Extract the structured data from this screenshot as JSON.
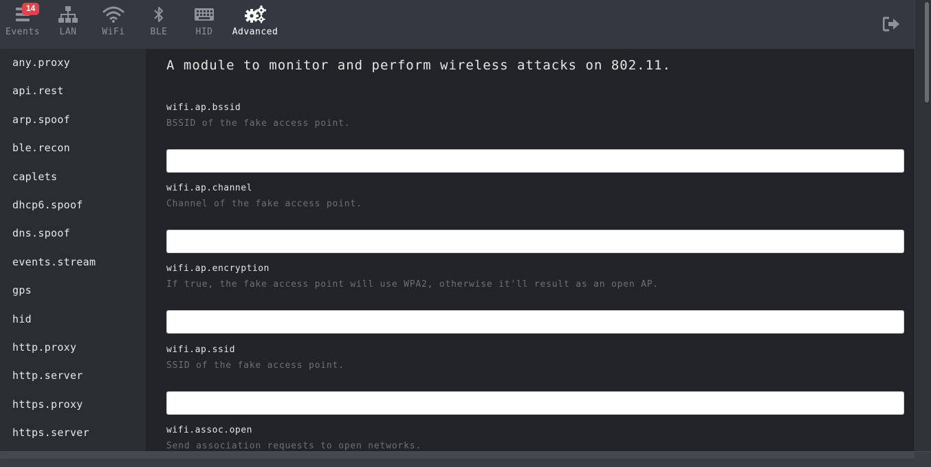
{
  "nav": {
    "events": {
      "label": "Events",
      "badge": "14"
    },
    "lan": {
      "label": "LAN"
    },
    "wifi": {
      "label": "WiFi"
    },
    "ble": {
      "label": "BLE"
    },
    "hid": {
      "label": "HID"
    },
    "advanced": {
      "label": "Advanced",
      "active": true
    }
  },
  "logout": {
    "icon": "logout-icon"
  },
  "sidebar": {
    "items": [
      {
        "label": "any.proxy"
      },
      {
        "label": "api.rest"
      },
      {
        "label": "arp.spoof"
      },
      {
        "label": "ble.recon"
      },
      {
        "label": "caplets"
      },
      {
        "label": "dhcp6.spoof"
      },
      {
        "label": "dns.spoof"
      },
      {
        "label": "events.stream"
      },
      {
        "label": "gps"
      },
      {
        "label": "hid"
      },
      {
        "label": "http.proxy"
      },
      {
        "label": "http.server"
      },
      {
        "label": "https.proxy"
      },
      {
        "label": "https.server"
      }
    ]
  },
  "main": {
    "description": "A module to monitor and perform wireless attacks on 802.11.",
    "params": [
      {
        "name": "wifi.ap.bssid",
        "help": "BSSID of the fake access point.",
        "value": ""
      },
      {
        "name": "wifi.ap.channel",
        "help": "Channel of the fake access point.",
        "value": ""
      },
      {
        "name": "wifi.ap.encryption",
        "help": "If true, the fake access point will use WPA2, otherwise it'll result as an open AP.",
        "value": ""
      },
      {
        "name": "wifi.ap.ssid",
        "help": "SSID of the fake access point.",
        "value": ""
      },
      {
        "name": "wifi.assoc.open",
        "help": "Send association requests to open networks."
      }
    ]
  },
  "colors": {
    "background": "#222428",
    "sidebar": "#2a2d32",
    "topbar": "#343840",
    "badge": "#e0434d",
    "muted": "#8e939b"
  }
}
